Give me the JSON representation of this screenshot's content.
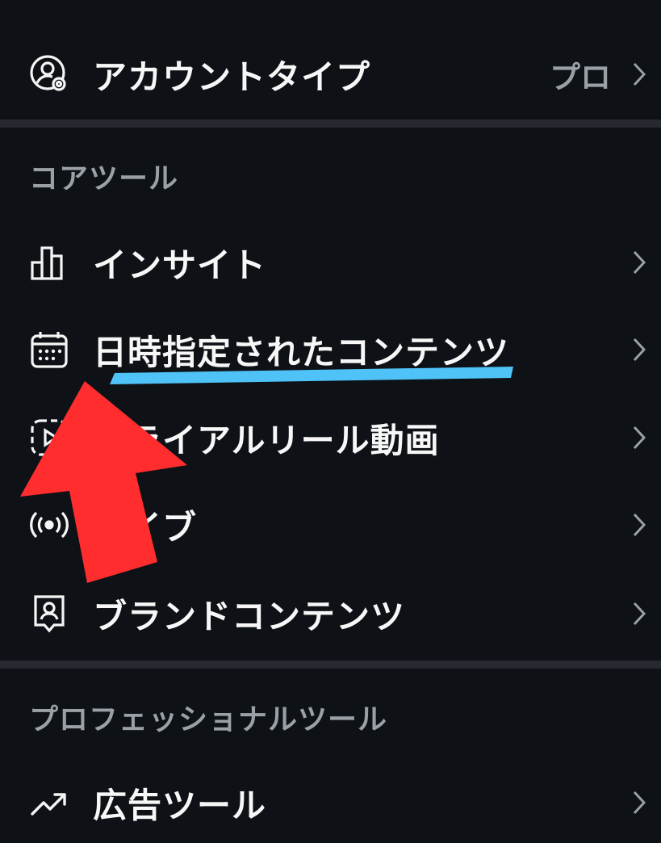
{
  "account_type": {
    "label": "アカウントタイプ",
    "value": "プロ"
  },
  "core_tools": {
    "heading": "コアツール",
    "items": [
      {
        "label": "インサイト"
      },
      {
        "label": "日時指定されたコンテンツ"
      },
      {
        "label": "トライアルリール動画"
      },
      {
        "label": "ライブ"
      },
      {
        "label": "ブランドコンテンツ"
      }
    ]
  },
  "pro_tools": {
    "heading": "プロフェッショナルツール",
    "items": [
      {
        "label": "広告ツール"
      }
    ]
  },
  "colors": {
    "background": "#0e1116",
    "divider": "#262a30",
    "highlight_underline": "#4fc3f7",
    "arrow": "#ff2d2d"
  }
}
